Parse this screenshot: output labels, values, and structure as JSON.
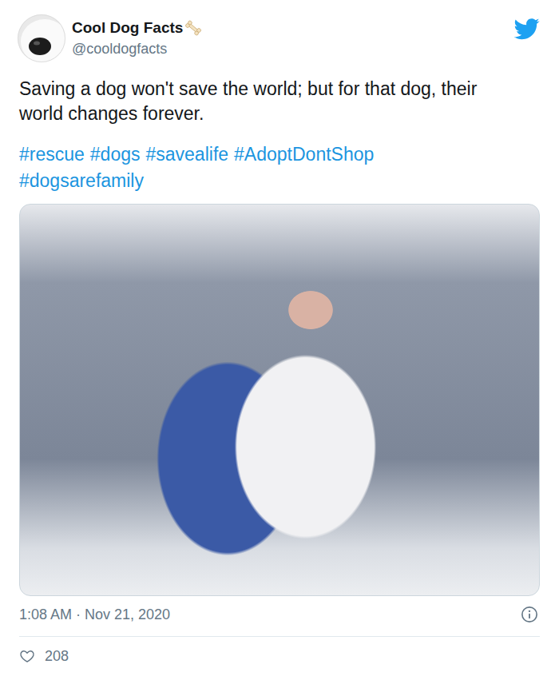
{
  "author": {
    "name": "Cool Dog Facts",
    "handle": "@cooldogfacts"
  },
  "tweet": {
    "text": "Saving a dog won't save the world; but for that dog, their world changes forever.",
    "hashtags": [
      "#rescue",
      "#dogs",
      "#savealife",
      "#AdoptDontShop",
      "#dogsarefamily"
    ]
  },
  "timestamp": "1:08 AM · Nov 21, 2020",
  "likes": "208"
}
